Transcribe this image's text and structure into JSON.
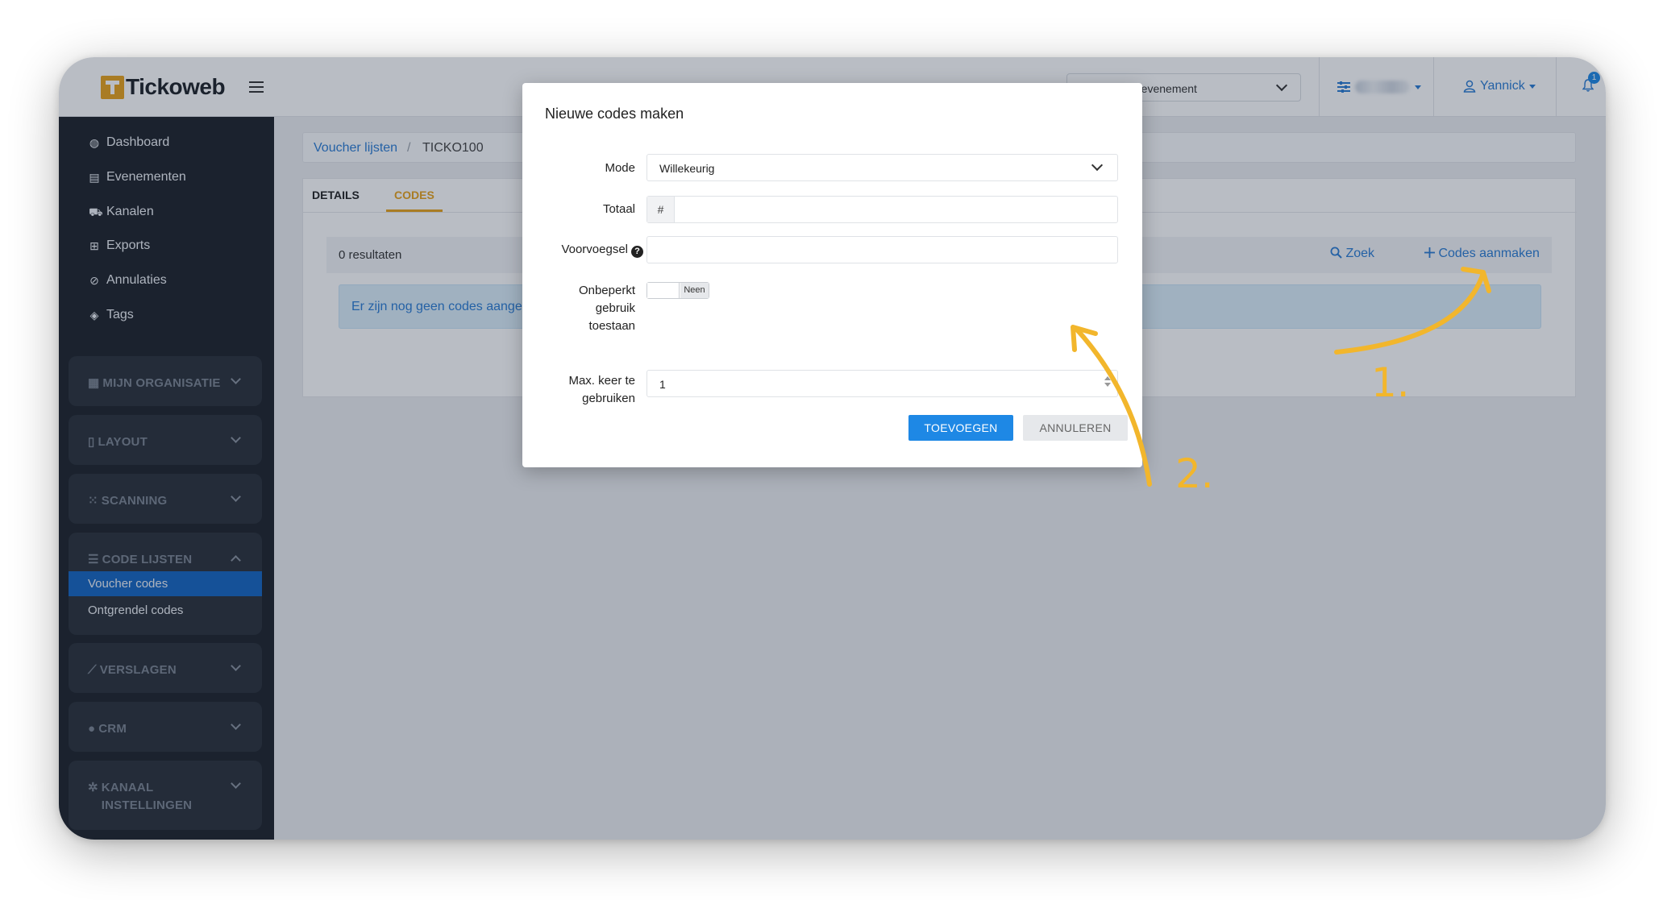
{
  "app": {
    "logo_text": "Tickoweb"
  },
  "topbar": {
    "event_select": "n evenement",
    "user_name": "Yannick",
    "notification_count": "1"
  },
  "sidebar": {
    "items": [
      {
        "label": "Dashboard",
        "icon": "dashboard-icon"
      },
      {
        "label": "Evenementen",
        "icon": "film-icon"
      },
      {
        "label": "Kanalen",
        "icon": "cart-icon"
      },
      {
        "label": "Exports",
        "icon": "table-icon"
      },
      {
        "label": "Annulaties",
        "icon": "ban-icon"
      },
      {
        "label": "Tags",
        "icon": "tags-icon"
      }
    ],
    "groups": [
      {
        "label": "MIJN ORGANISATIE",
        "icon": "building-icon"
      },
      {
        "label": "LAYOUT",
        "icon": "file-icon"
      },
      {
        "label": "SCANNING",
        "icon": "qr-icon"
      },
      {
        "label": "CODE LIJSTEN",
        "icon": "list-icon",
        "expanded": true,
        "subitems": [
          {
            "label": "Voucher codes",
            "active": true
          },
          {
            "label": "Ontgrendel codes"
          }
        ]
      },
      {
        "label": "VERSLAGEN",
        "icon": "chart-icon"
      },
      {
        "label": "CRM",
        "icon": "user-icon"
      },
      {
        "label": "KANAAL INSTELLINGEN",
        "icon": "cog-icon"
      }
    ]
  },
  "breadcrumb": {
    "link": "Voucher lijsten",
    "separator": "/",
    "current": "TICKO100"
  },
  "tabs": [
    {
      "label": "DETAILS"
    },
    {
      "label": "CODES",
      "active": true
    }
  ],
  "results": {
    "count_text": "0 resultaten",
    "search_label": "Zoek",
    "create_label": "Codes aanmaken",
    "empty_message": "Er zijn nog geen codes aange"
  },
  "modal": {
    "title": "Nieuwe codes maken",
    "fields": {
      "mode": {
        "label": "Mode",
        "value": "Willekeurig"
      },
      "total": {
        "label": "Totaal",
        "addon": "#",
        "value": ""
      },
      "prefix": {
        "label": "Voorvoegsel",
        "help": "?",
        "value": ""
      },
      "unlimited": {
        "label_lines": [
          "Onbeperkt",
          "gebruik",
          "toestaan"
        ],
        "toggle_text": "Neen"
      },
      "max_uses": {
        "label_lines": [
          "Max. keer te",
          "gebruiken"
        ],
        "value": "1"
      }
    },
    "buttons": {
      "add": "TOEVOEGEN",
      "cancel": "ANNULEREN"
    }
  },
  "annotations": {
    "step1": "1.",
    "step2": "2.",
    "color": "#f2b62c"
  },
  "colors": {
    "accent": "#1e88e5",
    "brand": "#e9a21a",
    "sidebar_bg": "#1d2229",
    "active_nav": "#1565c0"
  }
}
